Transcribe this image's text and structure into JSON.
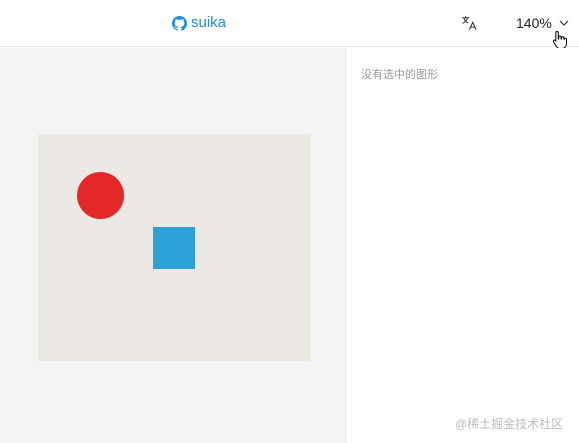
{
  "header": {
    "brand_label": "suika",
    "brand_icon": "github-icon",
    "translate_icon": "translate-icon",
    "zoom_value": "140%",
    "zoom_icon": "chevron-down-icon"
  },
  "colors": {
    "brand": "#1b8fe9",
    "circle_fill": "#e42727",
    "rect_fill": "#2d9fd9",
    "frame_fill": "#ece8e4",
    "canvas_bg": "#f4f4f4"
  },
  "panel": {
    "empty_text": "没有选中的图形"
  },
  "watermark": "@稀土掘金技术社区"
}
